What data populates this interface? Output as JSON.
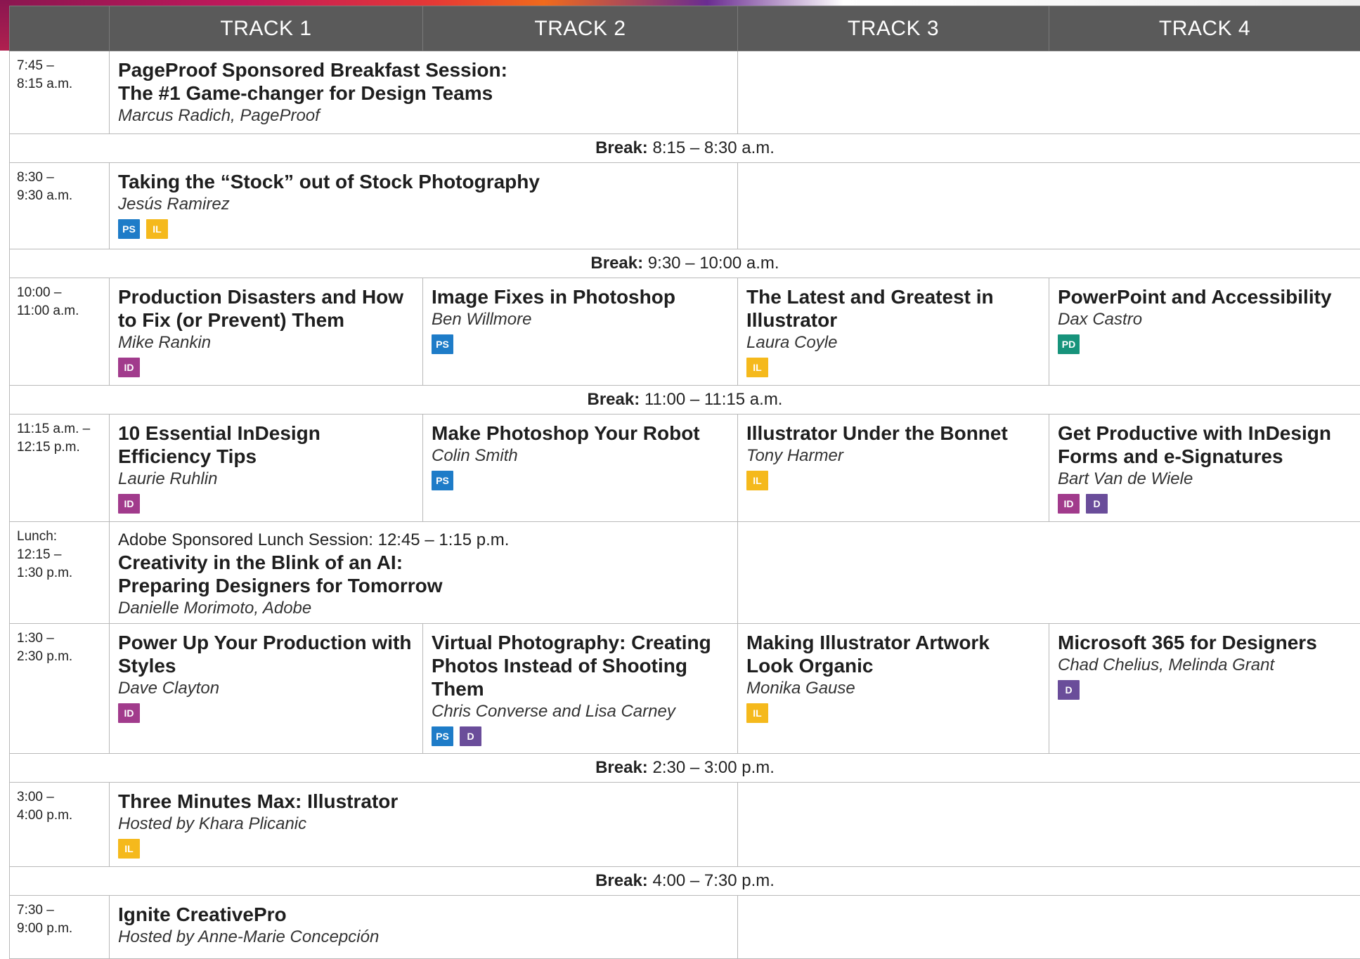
{
  "header": {
    "tracks": [
      "TRACK 1",
      "TRACK 2",
      "TRACK 3",
      "TRACK 4"
    ]
  },
  "colors": {
    "header_bg": "#5a5a5a",
    "ps": "#1e7cc8",
    "il": "#f5b91c",
    "id": "#a13b8c",
    "d": "#6a4d9a",
    "pd": "#17937b"
  },
  "rows": [
    {
      "time": [
        "7:45 –",
        "8:15 a.m."
      ],
      "wide": {
        "title": [
          "PageProof Sponsored Breakfast Session:",
          "The #1 Game-changer for Design Teams"
        ],
        "speaker": "Marcus Radich, PageProof"
      }
    },
    {
      "break_label": "Break:",
      "break_time": "8:15 – 8:30 a.m."
    },
    {
      "time": [
        "8:30 –",
        "9:30 a.m."
      ],
      "wide": {
        "title": "Taking the “Stock” out of Stock Photography",
        "speaker": "Jesús Ramirez",
        "badges": [
          "PS",
          "IL"
        ]
      }
    },
    {
      "break_label": "Break:",
      "break_time": "9:30 – 10:00 a.m."
    },
    {
      "time": [
        "10:00 –",
        "11:00 a.m."
      ],
      "sessions": [
        {
          "title": "Production Disasters and How to Fix (or Prevent) Them",
          "speaker": "Mike Rankin",
          "badges": [
            "ID"
          ]
        },
        {
          "title": "Image Fixes in Photoshop",
          "speaker": "Ben Willmore",
          "badges": [
            "PS"
          ]
        },
        {
          "title": "The Latest and Greatest in Illustrator",
          "speaker": "Laura Coyle",
          "badges": [
            "IL"
          ]
        },
        {
          "title": "PowerPoint and Accessibility",
          "speaker": "Dax Castro",
          "badges": [
            "PD"
          ]
        }
      ]
    },
    {
      "break_label": "Break:",
      "break_time": "11:00 – 11:15 a.m."
    },
    {
      "time": [
        "11:15 a.m. –",
        "12:15 p.m."
      ],
      "sessions": [
        {
          "title": "10 Essential InDesign Efficiency Tips",
          "speaker": "Laurie Ruhlin",
          "badges": [
            "ID"
          ]
        },
        {
          "title": "Make Photoshop Your Robot",
          "speaker": "Colin Smith",
          "badges": [
            "PS"
          ]
        },
        {
          "title": "Illustrator Under the Bonnet",
          "speaker": "Tony Harmer",
          "badges": [
            "IL"
          ]
        },
        {
          "title": "Get Productive with InDesign Forms and e-Signatures",
          "speaker": "Bart Van de Wiele",
          "badges": [
            "ID",
            "D"
          ]
        }
      ]
    },
    {
      "time": [
        "Lunch:",
        "12:15 –",
        "1:30 p.m."
      ],
      "wide": {
        "pre": "Adobe Sponsored Lunch Session: 12:45 – 1:15 p.m.",
        "title": [
          "Creativity in the Blink of an AI:",
          "Preparing Designers for Tomorrow"
        ],
        "speaker": "Danielle Morimoto, Adobe"
      }
    },
    {
      "time": [
        "1:30 –",
        "2:30 p.m."
      ],
      "sessions": [
        {
          "title": "Power Up Your Production with Styles",
          "speaker": "Dave Clayton",
          "badges": [
            "ID"
          ]
        },
        {
          "title": "Virtual Photography: Creating Photos Instead of Shooting Them",
          "speaker": "Chris Converse and Lisa Carney",
          "badges": [
            "PS",
            "D"
          ]
        },
        {
          "title": "Making Illustrator Artwork Look Organic",
          "speaker": "Monika Gause",
          "badges": [
            "IL"
          ]
        },
        {
          "title": "Microsoft 365 for Designers",
          "speaker": "Chad Chelius, Melinda Grant",
          "badges": [
            "D"
          ]
        }
      ]
    },
    {
      "break_label": "Break:",
      "break_time": "2:30 – 3:00 p.m."
    },
    {
      "time": [
        "3:00 –",
        "4:00 p.m."
      ],
      "wide": {
        "title": "Three Minutes Max: Illustrator",
        "speaker": "Hosted by Khara Plicanic",
        "badges": [
          "IL"
        ]
      }
    },
    {
      "break_label": "Break:",
      "break_time": "4:00 – 7:30 p.m."
    },
    {
      "time": [
        "7:30 –",
        "9:00 p.m."
      ],
      "wide": {
        "title": "Ignite CreativePro",
        "speaker": "Hosted by Anne-Marie Concepción"
      }
    }
  ]
}
